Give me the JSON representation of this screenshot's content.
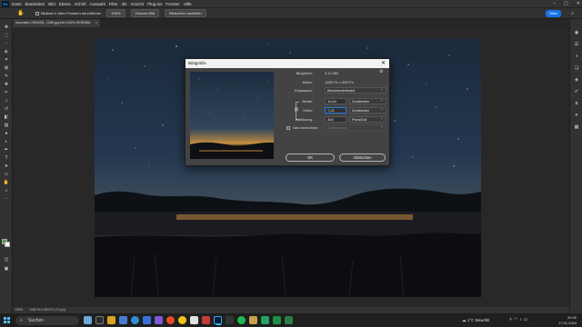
{
  "app": {
    "logo": "Ps",
    "menu": [
      "Datei",
      "Bearbeiten",
      "Bild",
      "Ebene",
      "Schrift",
      "Auswahl",
      "Filter",
      "3D",
      "Ansicht",
      "Plug-ins",
      "Fenster",
      "Hilfe"
    ],
    "window_controls": [
      "–",
      "▢",
      "✕"
    ]
  },
  "options_bar": {
    "scroll_all": "Bildlauf in allen Fenstern durchführen",
    "zoom_100": "100%",
    "fit_screen": "Ganzes Bild",
    "fill_screen": "Bildschirm ausfüllen",
    "share": "Teilen"
  },
  "document_tab": {
    "title": "mountain-7694951_1280.jpg bei 100% (RGB/8#)",
    "close": "×"
  },
  "status": {
    "zoom": "100%",
    "size": "1280 Px x 853 Px (72 ppi)"
  },
  "dialog": {
    "title": "Bildgröße",
    "image_size_label": "Bildgröße:",
    "image_size_value": "3,12 MB",
    "dims_label": "Maße:",
    "dims_value": "1280 Px  ×  853 Px",
    "fit_label": "Einpassen:",
    "fit_value": "Benutzerdefiniert",
    "width_label": "Breite:",
    "width_value": "10,84",
    "width_unit": "Zentimeter",
    "height_label": "Höhe:",
    "height_value": "7,22",
    "height_unit": "Zentimeter",
    "res_label": "Auflösung:",
    "res_value": "300",
    "res_unit": "Pixel/Zoll",
    "resample_label": "Neu berechnen:",
    "resample_value": "Automatisch",
    "ok": "OK",
    "cancel": "Abbrechen"
  },
  "taskbar": {
    "search": "Suchen",
    "weather": "Bewölkt",
    "temp": "1°C",
    "time": "20:26",
    "date": "17.01.2024"
  }
}
